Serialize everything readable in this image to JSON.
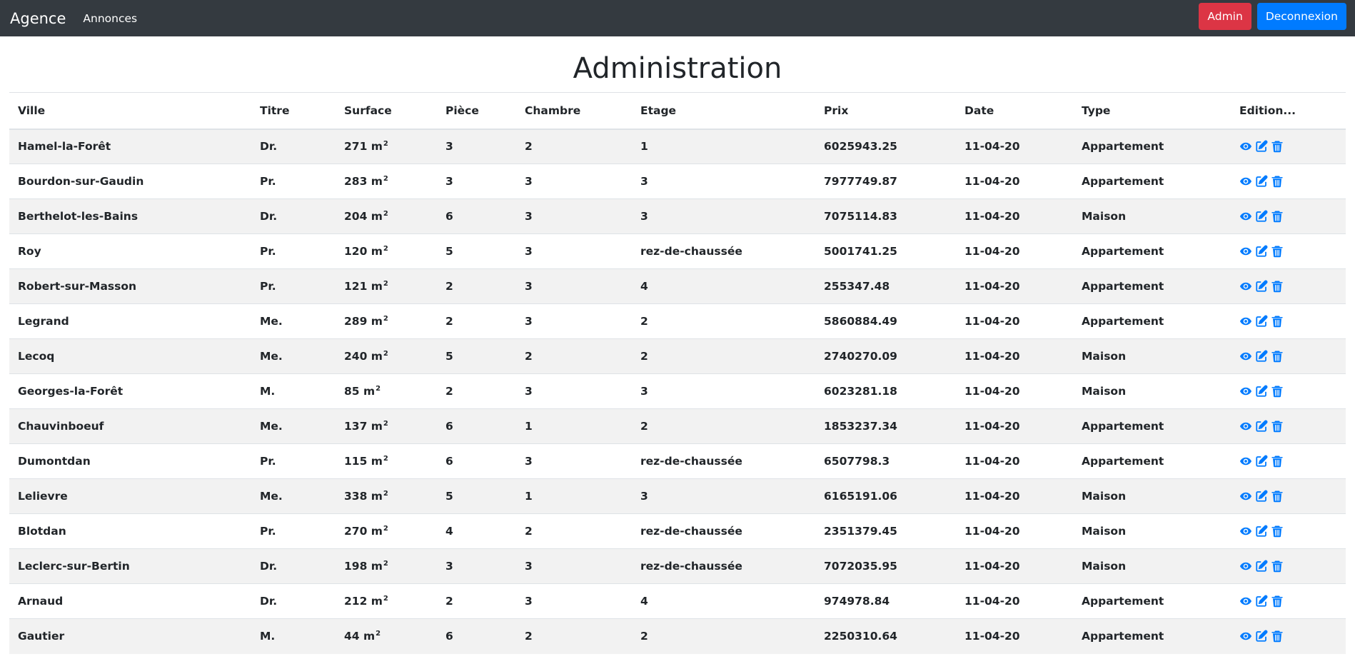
{
  "navbar": {
    "brand": "Agence",
    "link_annonces": "Annonces",
    "admin_label": "Admin",
    "logout_label": "Deconnexion"
  },
  "page_title": "Administration",
  "table": {
    "headers": [
      "Ville",
      "Titre",
      "Surface",
      "Pièce",
      "Chambre",
      "Etage",
      "Prix",
      "Date",
      "Type",
      "Edition..."
    ],
    "surface_unit": "m",
    "surface_exp": "2",
    "rows": [
      {
        "ville": "Hamel-la-Forêt",
        "titre": "Dr.",
        "surface": "271",
        "piece": "3",
        "chambre": "2",
        "etage": "1",
        "prix": "6025943.25",
        "date": "11-04-20",
        "type": "Appartement"
      },
      {
        "ville": "Bourdon-sur-Gaudin",
        "titre": "Pr.",
        "surface": "283",
        "piece": "3",
        "chambre": "3",
        "etage": "3",
        "prix": "7977749.87",
        "date": "11-04-20",
        "type": "Appartement"
      },
      {
        "ville": "Berthelot-les-Bains",
        "titre": "Dr.",
        "surface": "204",
        "piece": "6",
        "chambre": "3",
        "etage": "3",
        "prix": "7075114.83",
        "date": "11-04-20",
        "type": "Maison"
      },
      {
        "ville": "Roy",
        "titre": "Pr.",
        "surface": "120",
        "piece": "5",
        "chambre": "3",
        "etage": "rez-de-chaussée",
        "prix": "5001741.25",
        "date": "11-04-20",
        "type": "Appartement"
      },
      {
        "ville": "Robert-sur-Masson",
        "titre": "Pr.",
        "surface": "121",
        "piece": "2",
        "chambre": "3",
        "etage": "4",
        "prix": "255347.48",
        "date": "11-04-20",
        "type": "Appartement"
      },
      {
        "ville": "Legrand",
        "titre": "Me.",
        "surface": "289",
        "piece": "2",
        "chambre": "3",
        "etage": "2",
        "prix": "5860884.49",
        "date": "11-04-20",
        "type": "Appartement"
      },
      {
        "ville": "Lecoq",
        "titre": "Me.",
        "surface": "240",
        "piece": "5",
        "chambre": "2",
        "etage": "2",
        "prix": "2740270.09",
        "date": "11-04-20",
        "type": "Maison"
      },
      {
        "ville": "Georges-la-Forêt",
        "titre": "M.",
        "surface": "85",
        "piece": "2",
        "chambre": "3",
        "etage": "3",
        "prix": "6023281.18",
        "date": "11-04-20",
        "type": "Maison"
      },
      {
        "ville": "Chauvinboeuf",
        "titre": "Me.",
        "surface": "137",
        "piece": "6",
        "chambre": "1",
        "etage": "2",
        "prix": "1853237.34",
        "date": "11-04-20",
        "type": "Appartement"
      },
      {
        "ville": "Dumontdan",
        "titre": "Pr.",
        "surface": "115",
        "piece": "6",
        "chambre": "3",
        "etage": "rez-de-chaussée",
        "prix": "6507798.3",
        "date": "11-04-20",
        "type": "Appartement"
      },
      {
        "ville": "Lelievre",
        "titre": "Me.",
        "surface": "338",
        "piece": "5",
        "chambre": "1",
        "etage": "3",
        "prix": "6165191.06",
        "date": "11-04-20",
        "type": "Maison"
      },
      {
        "ville": "Blotdan",
        "titre": "Pr.",
        "surface": "270",
        "piece": "4",
        "chambre": "2",
        "etage": "rez-de-chaussée",
        "prix": "2351379.45",
        "date": "11-04-20",
        "type": "Maison"
      },
      {
        "ville": "Leclerc-sur-Bertin",
        "titre": "Dr.",
        "surface": "198",
        "piece": "3",
        "chambre": "3",
        "etage": "rez-de-chaussée",
        "prix": "7072035.95",
        "date": "11-04-20",
        "type": "Maison"
      },
      {
        "ville": "Arnaud",
        "titre": "Dr.",
        "surface": "212",
        "piece": "2",
        "chambre": "3",
        "etage": "4",
        "prix": "974978.84",
        "date": "11-04-20",
        "type": "Appartement"
      },
      {
        "ville": "Gautier",
        "titre": "M.",
        "surface": "44",
        "piece": "6",
        "chambre": "2",
        "etage": "2",
        "prix": "2250310.64",
        "date": "11-04-20",
        "type": "Appartement"
      }
    ]
  },
  "colors": {
    "navbar_bg": "#343a40",
    "admin_btn": "#dc3545",
    "logout_btn": "#007bff",
    "icon_color": "#007bff",
    "row_stripe": "#f2f2f2"
  },
  "icons": [
    "eye-icon",
    "edit-icon",
    "trash-icon"
  ]
}
